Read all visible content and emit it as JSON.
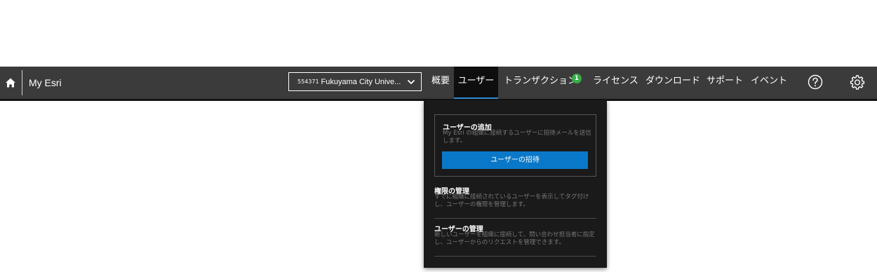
{
  "header": {
    "brand": "My Esri",
    "account": {
      "number": "554371",
      "name": "Fukuyama City Unive..."
    },
    "nav": {
      "overview": "概要",
      "users": "ユーザー",
      "transactions": "トランザクション",
      "transactions_badge": "1",
      "licenses": "ライセンス",
      "downloads": "ダウンロード",
      "support": "サポート",
      "events": "イベント"
    },
    "icons": {
      "home": "home-icon",
      "chevron": "chevron-down-icon",
      "help": "help-icon",
      "settings": "gear-icon"
    }
  },
  "users_menu": {
    "add_user": {
      "title": "ユーザーの追加",
      "description": "My Esri の組織に接続するユーザーに招待メールを送信します。",
      "button": "ユーザーの招待"
    },
    "permissions": {
      "title": "権限の管理",
      "description": "すでに組織に接続されているユーザーを表示してタグ付けし、ユーザーの権限を管理します。"
    },
    "manage_users": {
      "title": "ユーザーの管理",
      "description": "新しいユーザーを組織に接続して、問い合わせ担当者に指定し、ユーザーからのリクエストを管理できます。"
    }
  },
  "colors": {
    "navbar": "#3b3b3b",
    "active_tab": "#0e0e0e",
    "active_underline": "#2f8fd8",
    "dropdown_bg": "#1a1a1a",
    "primary_button": "#0a78c8",
    "badge": "#35ac46"
  }
}
